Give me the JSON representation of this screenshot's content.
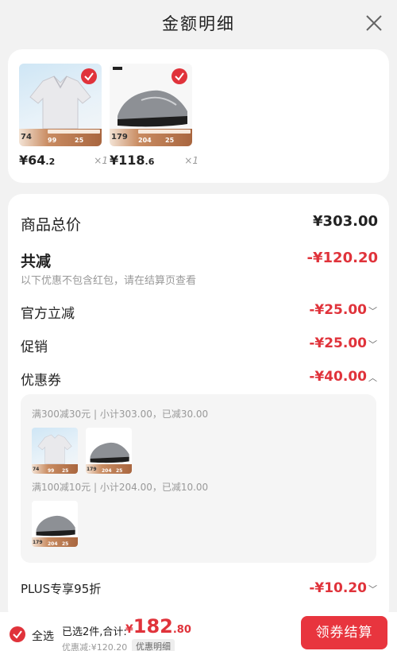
{
  "header": {
    "title": "金额明细"
  },
  "products": [
    {
      "price_int": "¥64",
      "price_dec": ".2",
      "qty": "×1",
      "thumb_price": "74",
      "thumb_a": "99",
      "thumb_b": "25"
    },
    {
      "price_int": "¥118",
      "price_dec": ".6",
      "qty": "×1",
      "thumb_price": "179",
      "thumb_a": "204",
      "thumb_b": "25"
    }
  ],
  "summary": {
    "total_label": "商品总价",
    "total_value": "¥303.00",
    "reduce_label": "共减",
    "reduce_value": "-¥120.20",
    "reduce_note": "以下优惠不包含红包，请在结算页查看",
    "official_label": "官方立减",
    "official_value": "-¥25.00",
    "promo_label": "促销",
    "promo_value": "-¥25.00",
    "coupon_label": "优惠券",
    "coupon_value": "-¥40.00",
    "plus_label": "PLUS专享95折",
    "plus_value": "-¥10.20"
  },
  "coupons": [
    {
      "rule": "满300减30元 | 小计303.00，已减30.00"
    },
    {
      "rule": "满100减10元 | 小计204.00，已减10.00"
    }
  ],
  "bottom": {
    "select_all": "全选",
    "selected": "已选2件,合计:",
    "total_cur": "¥",
    "total_int": "182",
    "total_dec": ".80",
    "discount": "优惠减:¥120.20",
    "detail": "优惠明细",
    "checkout": "领券结算"
  },
  "colors": {
    "accent": "#e0333b",
    "background": "#f2f2f2"
  }
}
